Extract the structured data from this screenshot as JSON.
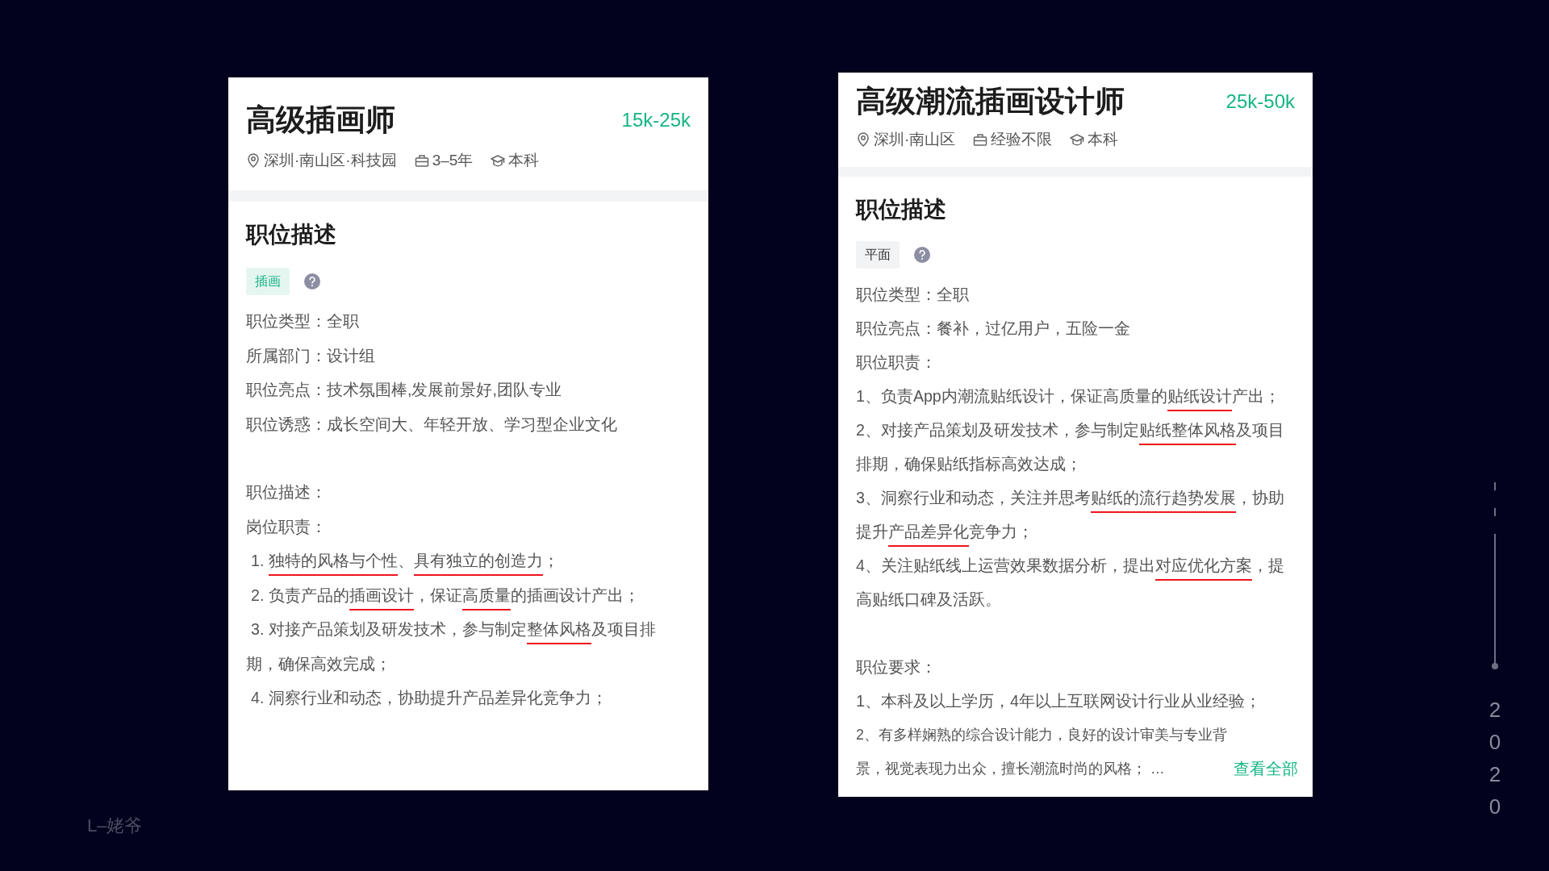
{
  "signature": "L–姥爷",
  "cards": [
    {
      "title": "高级插画师",
      "salary": "15k-25k",
      "meta": [
        {
          "kind": "location",
          "text": "深圳·南山区·科技园"
        },
        {
          "kind": "experience",
          "text": "3–5年"
        },
        {
          "kind": "education",
          "text": "本科"
        }
      ],
      "section_title": "职位描述",
      "tag": {
        "kind": "highlight",
        "text": "插画"
      },
      "sections": [
        [
          {
            "kind": "plain",
            "parts": [
              {
                "text": "职位类型：全职",
                "underlined": false
              }
            ]
          },
          {
            "kind": "plain",
            "parts": [
              {
                "text": "所属部门：设计组",
                "underlined": false
              }
            ]
          },
          {
            "kind": "plain",
            "parts": [
              {
                "text": "职位亮点：技术氛围棒,发展前景好,团队专业",
                "underlined": false
              }
            ]
          },
          {
            "kind": "plain",
            "parts": [
              {
                "text": "职位诱惑：成长空间大、年轻开放、学习型企业文化",
                "underlined": false
              }
            ]
          }
        ],
        [
          {
            "kind": "plain",
            "parts": [
              {
                "text": "职位描述：",
                "underlined": false
              }
            ]
          },
          {
            "kind": "plain",
            "parts": [
              {
                "text": "岗位职责：",
                "underlined": false
              }
            ]
          },
          {
            "kind": "item",
            "parts": [
              {
                "text": "1. ",
                "underlined": false
              },
              {
                "text": "独特的风格与个性",
                "underlined": true
              },
              {
                "text": "、",
                "underlined": false
              },
              {
                "text": "具有独立的创造力",
                "underlined": true
              },
              {
                "text": "；",
                "underlined": false
              }
            ]
          },
          {
            "kind": "item",
            "parts": [
              {
                "text": "2. 负责产品的",
                "underlined": false
              },
              {
                "text": "插画设计",
                "underlined": true
              },
              {
                "text": "，保证",
                "underlined": false
              },
              {
                "text": "高质量",
                "underlined": true
              },
              {
                "text": "的插画设计产出；",
                "underlined": false
              }
            ]
          },
          {
            "kind": "item",
            "parts": [
              {
                "text": "3. 对接产品策划及研发技术，参与制定",
                "underlined": false
              },
              {
                "text": "整体风格",
                "underlined": true
              },
              {
                "text": "及项目排期，确保高效完成；",
                "underlined": false
              }
            ]
          },
          {
            "kind": "item",
            "parts": [
              {
                "text": "4. 洞察行业和动态，协助提升产品差异化竞争力；",
                "underlined": false
              }
            ]
          }
        ]
      ]
    },
    {
      "title": "高级潮流插画设计师",
      "salary": "25k-50k",
      "meta": [
        {
          "kind": "location",
          "text": "深圳·南山区"
        },
        {
          "kind": "experience",
          "text": "经验不限"
        },
        {
          "kind": "education",
          "text": "本科"
        }
      ],
      "section_title": "职位描述",
      "tag": {
        "kind": "plain",
        "text": "平面"
      },
      "sections": [
        [
          {
            "kind": "plain",
            "parts": [
              {
                "text": "职位类型：全职",
                "underlined": false
              }
            ]
          },
          {
            "kind": "plain",
            "parts": [
              {
                "text": "职位亮点：餐补，过亿用户，五险一金",
                "underlined": false
              }
            ]
          },
          {
            "kind": "plain",
            "parts": [
              {
                "text": "职位职责：",
                "underlined": false
              }
            ]
          },
          {
            "kind": "plain",
            "parts": [
              {
                "text": "1、负责App内潮流贴纸设计，保证高质量的",
                "underlined": false
              },
              {
                "text": "贴纸设计",
                "underlined": true
              },
              {
                "text": "产出；",
                "underlined": false
              }
            ]
          },
          {
            "kind": "plain",
            "parts": [
              {
                "text": "2、对接产品策划及研发技术，参与制定",
                "underlined": false
              },
              {
                "text": "贴纸整体风格",
                "underlined": true
              },
              {
                "text": "及项目排期，确保贴纸指标高效达成；",
                "underlined": false
              }
            ]
          },
          {
            "kind": "plain",
            "parts": [
              {
                "text": "3、洞察行业和动态，关注并思考",
                "underlined": false
              },
              {
                "text": "贴纸的流行趋势发展",
                "underlined": true
              },
              {
                "text": "，协助提升",
                "underlined": false
              },
              {
                "text": "产品差异化",
                "underlined": true
              },
              {
                "text": "竞争力；",
                "underlined": false
              }
            ]
          },
          {
            "kind": "plain",
            "parts": [
              {
                "text": "4、关注贴纸线上运营效果数据分析，提出",
                "underlined": false
              },
              {
                "text": "对应优化方案",
                "underlined": true
              },
              {
                "text": "，提高贴纸口碑及活跃。",
                "underlined": false
              }
            ]
          }
        ],
        [
          {
            "kind": "plain",
            "parts": [
              {
                "text": "职位要求：",
                "underlined": false
              }
            ]
          },
          {
            "kind": "plain",
            "parts": [
              {
                "text": "1、本科及以上学历，4年以上互联网设计行业从业经验；",
                "underlined": false
              }
            ]
          },
          {
            "kind": "plain",
            "parts": [
              {
                "text": "2、有多样娴熟的综合设计能力，良好的设计审美与专业背景，视觉表现力出众，擅长潮流时尚的风格； …",
                "underlined": false
              }
            ]
          }
        ]
      ],
      "more_link": "查看全部"
    }
  ],
  "year": "2020"
}
